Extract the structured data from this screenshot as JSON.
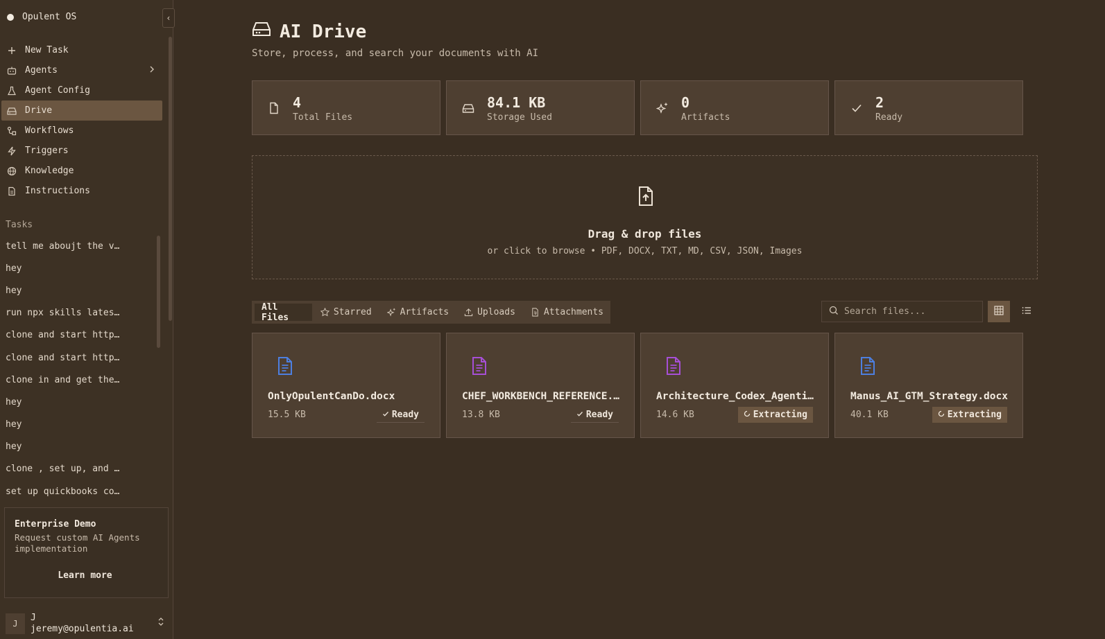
{
  "app": {
    "brand": "Opulent OS"
  },
  "sidebar": {
    "nav": [
      {
        "label": "New Task",
        "icon": "plus-icon"
      },
      {
        "label": "Agents",
        "icon": "bot-icon"
      },
      {
        "label": "Agent Config",
        "icon": "flask-icon"
      },
      {
        "label": "Drive",
        "icon": "drive-icon",
        "active": true
      },
      {
        "label": "Workflows",
        "icon": "workflow-icon"
      },
      {
        "label": "Triggers",
        "icon": "lightning-icon"
      },
      {
        "label": "Knowledge",
        "icon": "globe-icon"
      },
      {
        "label": "Instructions",
        "icon": "document-icon"
      }
    ],
    "tasks_title": "Tasks",
    "tasks": [
      "tell me aboujt the v…",
      "hey",
      "hey",
      "run npx skills lates…",
      "clone and start http…",
      "clone and start http…",
      "clone in and get the…",
      "hey",
      "hey",
      "hey",
      "clone , set up, and …",
      "set up quickbooks co…"
    ],
    "promo": {
      "title": "Enterprise Demo",
      "description": "Request custom AI Agents implementation",
      "button": "Learn more"
    },
    "user": {
      "initial": "J",
      "name": "J",
      "email": "jeremy@opulentia.ai"
    }
  },
  "header": {
    "title": "AI Drive",
    "subtitle": "Store, process, and search your documents with AI"
  },
  "stats": [
    {
      "value": "4",
      "label": "Total Files",
      "icon": "file-icon"
    },
    {
      "value": "84.1 KB",
      "label": "Storage Used",
      "icon": "drive-icon"
    },
    {
      "value": "0",
      "label": "Artifacts",
      "icon": "sparkles-icon"
    },
    {
      "value": "2",
      "label": "Ready",
      "icon": "check-icon"
    }
  ],
  "dropzone": {
    "title": "Drag & drop files",
    "subtitle": "or click to browse • PDF, DOCX, TXT, MD, CSV, JSON, Images"
  },
  "tabs": [
    {
      "label": "All Files",
      "active": true
    },
    {
      "label": "Starred",
      "icon": "star-icon"
    },
    {
      "label": "Artifacts",
      "icon": "sparkles-icon"
    },
    {
      "label": "Uploads",
      "icon": "upload-icon"
    },
    {
      "label": "Attachments",
      "icon": "attachment-icon"
    }
  ],
  "search": {
    "placeholder": "Search files..."
  },
  "files": [
    {
      "name": "OnlyOpulentCanDo.docx",
      "size": "15.5 KB",
      "status": "Ready",
      "color": "#4d7fe0"
    },
    {
      "name": "CHEF_WORKBENCH_REFERENCE.…",
      "size": "13.8 KB",
      "status": "Ready",
      "color": "#a64fd6"
    },
    {
      "name": "Architecture_Codex_Agenti…",
      "size": "14.6 KB",
      "status": "Extracting",
      "color": "#a64fd6"
    },
    {
      "name": "Manus_AI_GTM_Strategy.docx",
      "size": "40.1 KB",
      "status": "Extracting",
      "color": "#4d7fe0"
    }
  ]
}
